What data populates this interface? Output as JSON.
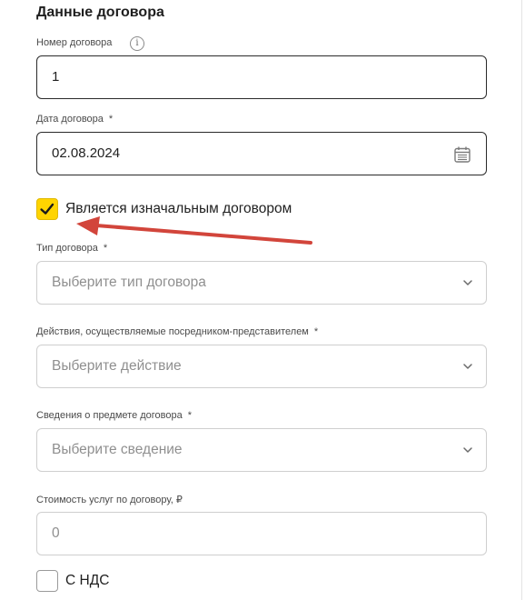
{
  "section": {
    "title": "Данные договора"
  },
  "contract_number": {
    "label": "Номер договора",
    "value": "1",
    "info_icon": "info-icon"
  },
  "contract_date": {
    "label": "Дата договора",
    "required": "*",
    "value": "02.08.2024",
    "icon": "calendar-icon"
  },
  "initial_contract": {
    "label": "Является изначальным договором",
    "checked": true
  },
  "contract_type": {
    "label": "Тип договора",
    "required": "*",
    "placeholder": "Выберите тип договора"
  },
  "actions": {
    "label": "Действия, осуществляемые посредником-представителем",
    "required": "*",
    "placeholder": "Выберите действие"
  },
  "subject": {
    "label": "Сведения о предмете договора",
    "required": "*",
    "placeholder": "Выберите сведение"
  },
  "cost": {
    "label": "Стоимость услуг по договору, ₽",
    "placeholder": "0"
  },
  "vat": {
    "label": "С НДС",
    "checked": false
  },
  "colors": {
    "accent": "#ffd400",
    "annotation_arrow": "#d2453b"
  }
}
